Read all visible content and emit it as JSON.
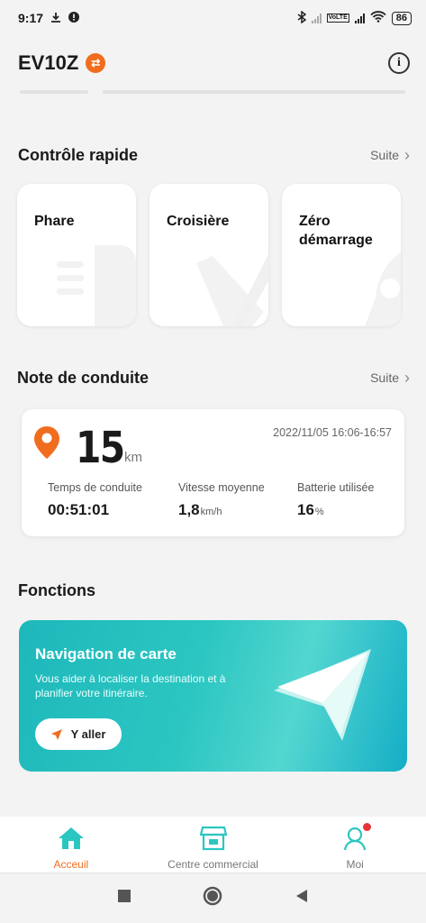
{
  "status_bar": {
    "time": "9:17",
    "network_tag": "VoLTE",
    "battery": "86"
  },
  "header": {
    "title": "EV10Z"
  },
  "quick_control": {
    "heading": "Contrôle rapide",
    "more_label": "Suite",
    "cards": [
      {
        "line1": "Phare",
        "line2": ""
      },
      {
        "line1": "Croisière",
        "line2": ""
      },
      {
        "line1": "Zéro",
        "line2": "démarrage"
      }
    ]
  },
  "driving_note": {
    "heading": "Note de conduite",
    "more_label": "Suite",
    "distance": "15",
    "distance_unit": "km",
    "datetime": "2022/11/05 16:06-16:57",
    "stats": [
      {
        "label": "Temps de conduite",
        "value": "00:51:01",
        "unit": ""
      },
      {
        "label": "Vitesse moyenne",
        "value": "1,8",
        "unit": "km/h"
      },
      {
        "label": "Batterie utilisée",
        "value": "16",
        "unit": "%"
      }
    ]
  },
  "functions": {
    "heading": "Fonctions",
    "nav_card": {
      "title": "Navigation de carte",
      "description": "Vous aider à localiser la destination et à planifier votre itinéraire.",
      "button_label": "Y aller"
    }
  },
  "tab_bar": {
    "tabs": [
      {
        "label": "Acceuil",
        "icon": "home-icon",
        "active": true
      },
      {
        "label": "Centre commercial",
        "icon": "store-icon",
        "active": false
      },
      {
        "label": "Moi",
        "icon": "user-icon",
        "active": false
      }
    ]
  },
  "colors": {
    "accent": "#f06d1e",
    "teal": "#2cc6c1",
    "notification": "#e5353a"
  }
}
